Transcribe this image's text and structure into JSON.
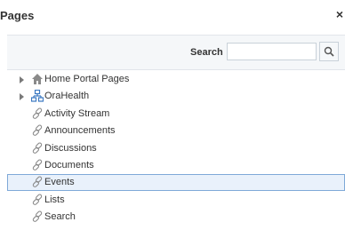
{
  "dialog": {
    "title": "Pages",
    "close_label": "×"
  },
  "search": {
    "label": "Search",
    "value": "",
    "placeholder": ""
  },
  "tree": {
    "items": [
      {
        "label": "Home Portal Pages",
        "icon": "home-icon",
        "expandable": true,
        "selected": false
      },
      {
        "label": "OraHealth",
        "icon": "sitemap-icon",
        "expandable": true,
        "selected": false
      },
      {
        "label": "Activity Stream",
        "icon": "link-icon",
        "expandable": false,
        "selected": false
      },
      {
        "label": "Announcements",
        "icon": "link-icon",
        "expandable": false,
        "selected": false
      },
      {
        "label": "Discussions",
        "icon": "link-icon",
        "expandable": false,
        "selected": false
      },
      {
        "label": "Documents",
        "icon": "link-icon",
        "expandable": false,
        "selected": false
      },
      {
        "label": "Events",
        "icon": "link-icon",
        "expandable": false,
        "selected": true
      },
      {
        "label": "Lists",
        "icon": "link-icon",
        "expandable": false,
        "selected": false
      },
      {
        "label": "Search",
        "icon": "link-icon",
        "expandable": false,
        "selected": false
      }
    ]
  },
  "colors": {
    "selection_bg": "#e9f1fb",
    "selection_border": "#7fa9d8",
    "sitemap_blue": "#3a78c2"
  }
}
